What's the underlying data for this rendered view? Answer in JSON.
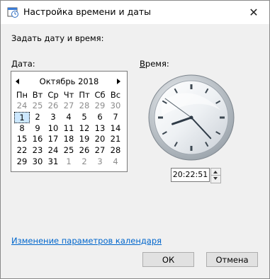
{
  "window": {
    "title": "Настройка времени и даты",
    "close_glyph": "✕"
  },
  "heading": "Задать дату и время:",
  "date_label": {
    "mnemonic": "Д",
    "rest": "ата:"
  },
  "time_label": {
    "mnemonic": "В",
    "rest": "ремя:"
  },
  "calendar": {
    "month_title": "Октябрь 2018",
    "weekdays": [
      "Пн",
      "Вт",
      "Ср",
      "Чт",
      "Пт",
      "Сб",
      "Вс"
    ],
    "days": [
      {
        "d": "24",
        "other": true
      },
      {
        "d": "25",
        "other": true
      },
      {
        "d": "26",
        "other": true
      },
      {
        "d": "27",
        "other": true
      },
      {
        "d": "28",
        "other": true
      },
      {
        "d": "29",
        "other": true
      },
      {
        "d": "30",
        "other": true
      },
      {
        "d": "1",
        "selected": true
      },
      {
        "d": "2"
      },
      {
        "d": "3"
      },
      {
        "d": "4"
      },
      {
        "d": "5"
      },
      {
        "d": "6"
      },
      {
        "d": "7"
      },
      {
        "d": "8"
      },
      {
        "d": "9"
      },
      {
        "d": "10"
      },
      {
        "d": "11"
      },
      {
        "d": "12"
      },
      {
        "d": "13"
      },
      {
        "d": "14"
      },
      {
        "d": "15"
      },
      {
        "d": "16"
      },
      {
        "d": "17"
      },
      {
        "d": "18"
      },
      {
        "d": "19"
      },
      {
        "d": "20"
      },
      {
        "d": "21"
      },
      {
        "d": "22"
      },
      {
        "d": "23"
      },
      {
        "d": "24"
      },
      {
        "d": "25"
      },
      {
        "d": "26"
      },
      {
        "d": "27"
      },
      {
        "d": "28"
      },
      {
        "d": "29"
      },
      {
        "d": "30"
      },
      {
        "d": "31"
      },
      {
        "d": "1",
        "other": true
      },
      {
        "d": "2",
        "other": true
      },
      {
        "d": "3",
        "other": true
      },
      {
        "d": "4",
        "other": true
      }
    ]
  },
  "clock": {
    "hour": 20,
    "minute": 22,
    "second": 51
  },
  "time_value": "20:22:51",
  "calendar_link": "Изменение параметров календаря",
  "buttons": {
    "ok": "ОК",
    "cancel": "Отмена"
  },
  "colors": {
    "link": "#0066cc",
    "selected_day_bg": "#cce8ff",
    "other_month_text": "#8c8c8c"
  }
}
